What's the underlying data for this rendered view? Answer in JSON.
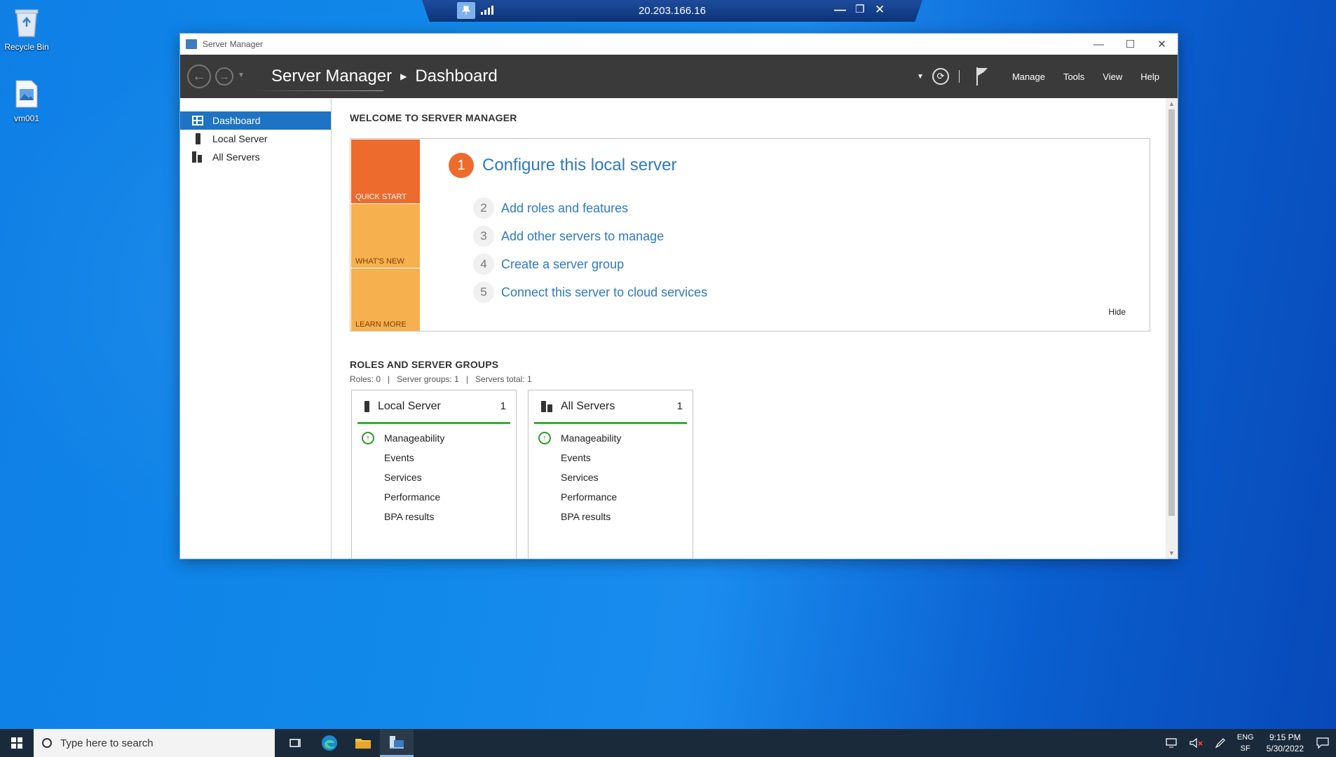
{
  "desktop": {
    "icons": [
      {
        "label": "Recycle Bin"
      },
      {
        "label": "vm001"
      }
    ]
  },
  "rdp": {
    "host": "20.203.166.16"
  },
  "window": {
    "title": "Server Manager",
    "breadcrumb": {
      "root": "Server Manager",
      "current": "Dashboard"
    },
    "menu": [
      "Manage",
      "Tools",
      "View",
      "Help"
    ]
  },
  "sidebar": {
    "items": [
      {
        "label": "Dashboard",
        "icon": "dashboard-icon",
        "active": true
      },
      {
        "label": "Local Server",
        "icon": "server-icon"
      },
      {
        "label": "All Servers",
        "icon": "servers-icon"
      }
    ]
  },
  "welcome": {
    "heading": "WELCOME TO SERVER MANAGER",
    "tiles": [
      "QUICK START",
      "WHAT'S NEW",
      "LEARN MORE"
    ],
    "main_step": {
      "num": "1",
      "label": "Configure this local server"
    },
    "steps": [
      {
        "num": "2",
        "label": "Add roles and features"
      },
      {
        "num": "3",
        "label": "Add other servers to manage"
      },
      {
        "num": "4",
        "label": "Create a server group"
      },
      {
        "num": "5",
        "label": "Connect this server to cloud services"
      }
    ],
    "hide_label": "Hide"
  },
  "roles": {
    "heading": "ROLES AND SERVER GROUPS",
    "summary": "Roles: 0   |   Server groups: 1   |   Servers total: 1",
    "cards": [
      {
        "title": "Local Server",
        "count": "1",
        "rows": [
          "Manageability",
          "Events",
          "Services",
          "Performance",
          "BPA results"
        ]
      },
      {
        "title": "All Servers",
        "count": "1",
        "rows": [
          "Manageability",
          "Events",
          "Services",
          "Performance",
          "BPA results"
        ]
      }
    ]
  },
  "taskbar": {
    "search_placeholder": "Type here to search",
    "lang": {
      "line1": "ENG",
      "line2": "SF"
    },
    "time": "9:15 PM",
    "date": "5/30/2022"
  },
  "colors": {
    "accent": "#1e73c4",
    "quick_start": "#ec6b2d",
    "tile_amber": "#f6b04e",
    "link": "#2f79c1",
    "status_ok": "#3aaa35"
  }
}
